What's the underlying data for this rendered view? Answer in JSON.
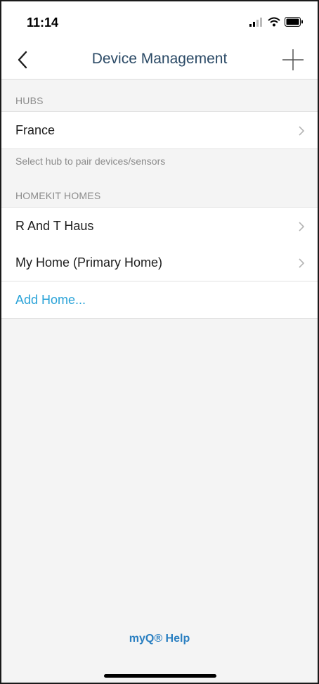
{
  "status_bar": {
    "time": "11:14",
    "icons": [
      "cellular-signal-icon",
      "wifi-icon",
      "battery-icon"
    ]
  },
  "nav": {
    "title": "Device Management",
    "back_icon": "chevron-left-icon",
    "add_icon": "plus-icon"
  },
  "hubs": {
    "header": "HUBS",
    "items": [
      {
        "label": "France"
      }
    ],
    "hint": "Select hub to pair devices/sensors"
  },
  "homekit": {
    "header": "HOMEKIT HOMES",
    "items": [
      {
        "label": "R And T Haus"
      },
      {
        "label": "My Home (Primary Home)"
      }
    ],
    "add_label": "Add Home..."
  },
  "footer": {
    "help_label": "myQ® Help"
  },
  "colors": {
    "title": "#2b4a66",
    "link": "#2aa3d8",
    "help": "#2a7fc1",
    "background": "#f4f4f4"
  }
}
